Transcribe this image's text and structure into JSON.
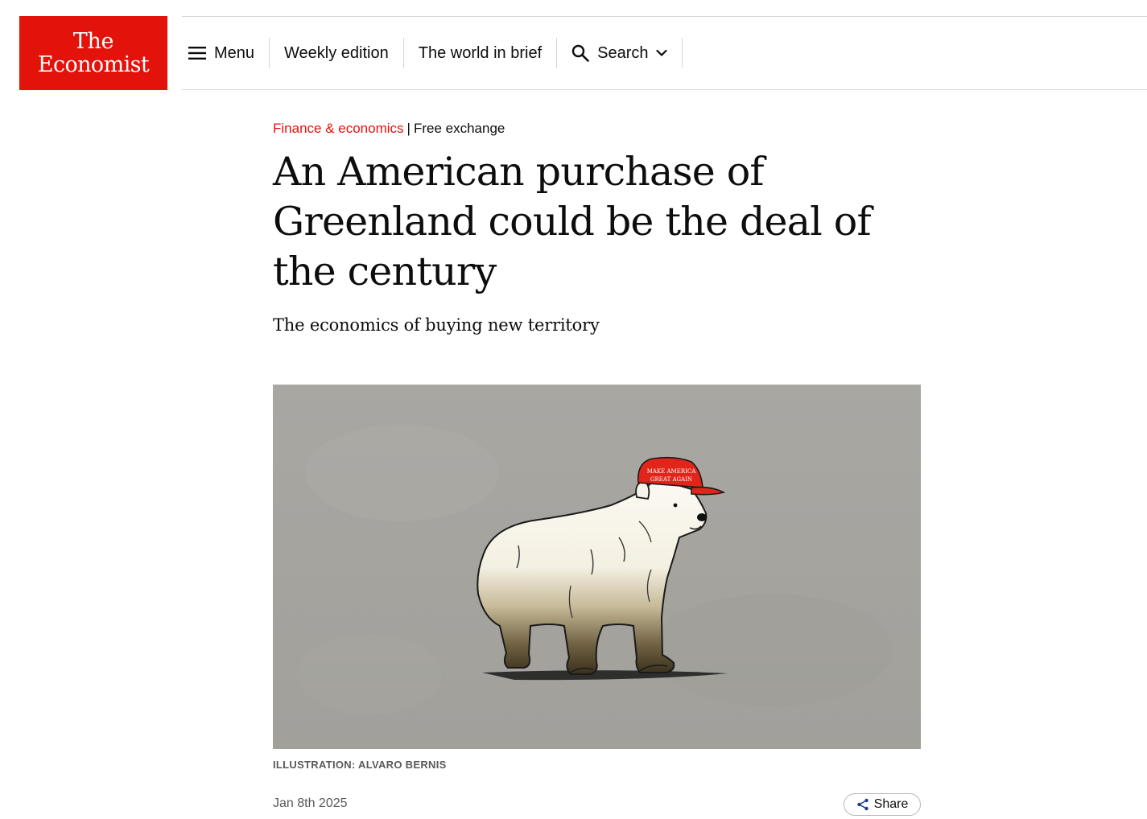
{
  "brand": {
    "line1": "The",
    "line2": "Economist",
    "color": "#e3120b"
  },
  "nav": {
    "menu_label": "Menu",
    "menu_icon": "hamburger-icon",
    "weekly_edition": "Weekly edition",
    "world_in_brief": "The world in brief",
    "search_label": "Search",
    "search_icon": "search-icon",
    "search_chevron_icon": "chevron-down-icon"
  },
  "article": {
    "section": "Finance & economics",
    "separator": "|",
    "column": "Free exchange",
    "headline": "An American purchase of Greenland could be the deal of the century",
    "subheadline": "The economics of buying new territory",
    "image_caption": "ILLUSTRATION: ALVARO BERNIS",
    "date": "Jan 8th 2025",
    "share_label": "Share",
    "share_icon": "share-icon",
    "illustration": {
      "subject": "polar-bear-illustration",
      "cap_text_line1": "MAKE AMERICA",
      "cap_text_line2": "GREAT AGAIN",
      "background_color": "#a6a49f",
      "cap_color": "#e1251b"
    }
  },
  "colors": {
    "accent_red": "#e3120b",
    "text": "#0d0d0d",
    "muted": "#595959",
    "rule": "#d7d7d7"
  }
}
